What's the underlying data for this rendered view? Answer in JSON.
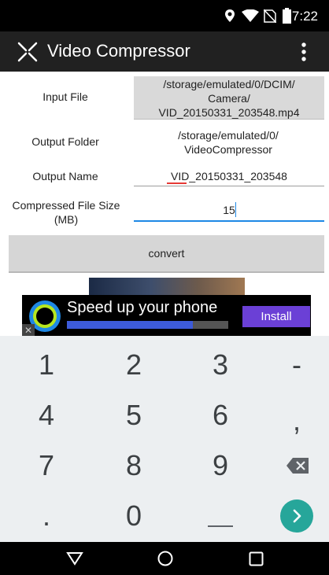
{
  "status_bar": {
    "time": "7:22"
  },
  "app_bar": {
    "title": "Video Compressor"
  },
  "form": {
    "input_file": {
      "label": "Input File",
      "value": "/storage/emulated/0/DCIM/\nCamera/\nVID_20150331_203548.mp4"
    },
    "output_folder": {
      "label": "Output Folder",
      "value": "/storage/emulated/0/\nVideoCompressor"
    },
    "output_name": {
      "label": "Output Name",
      "value": "VID_20150331_203548"
    },
    "compressed_size": {
      "label": "Compressed File Size\n(MB)",
      "value": "15"
    },
    "convert_label": "convert"
  },
  "ad": {
    "title": "Speed up your phone",
    "install_label": "Install",
    "progress": 0.78
  },
  "keyboard": {
    "rows": [
      [
        "1",
        "2",
        "3",
        "-"
      ],
      [
        "4",
        "5",
        "6",
        ","
      ],
      [
        "7",
        "8",
        "9",
        ""
      ],
      [
        ".",
        "0",
        "",
        ""
      ]
    ]
  },
  "colors": {
    "accent": "#1e88e5",
    "app_bar": "#212121",
    "enter_key": "#26a69a",
    "ad_button": "#6b40d6"
  }
}
